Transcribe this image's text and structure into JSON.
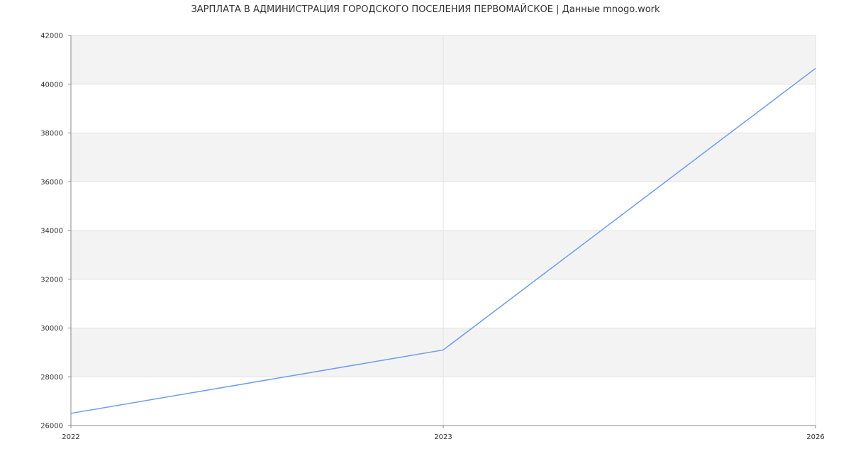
{
  "chart_data": {
    "type": "line",
    "title": "ЗАРПЛАТА В АДМИНИСТРАЦИЯ ГОРОДСКОГО ПОСЕЛЕНИЯ ПЕРВОМАЙСКОЕ | Данные mnogo.work",
    "xlabel": "",
    "ylabel": "",
    "x": [
      "2022",
      "2023",
      "2026"
    ],
    "ylim": [
      26000,
      42000
    ],
    "yticks": [
      26000,
      28000,
      30000,
      32000,
      34000,
      36000,
      38000,
      40000,
      42000
    ],
    "series": [
      {
        "values": [
          26500,
          29100,
          40650
        ]
      }
    ],
    "grid": true,
    "legend": "none",
    "colors": {
      "line": "#6f9ced",
      "band": "#f3f3f3",
      "grid": "#e2e2e2",
      "axis": "#888888"
    }
  }
}
